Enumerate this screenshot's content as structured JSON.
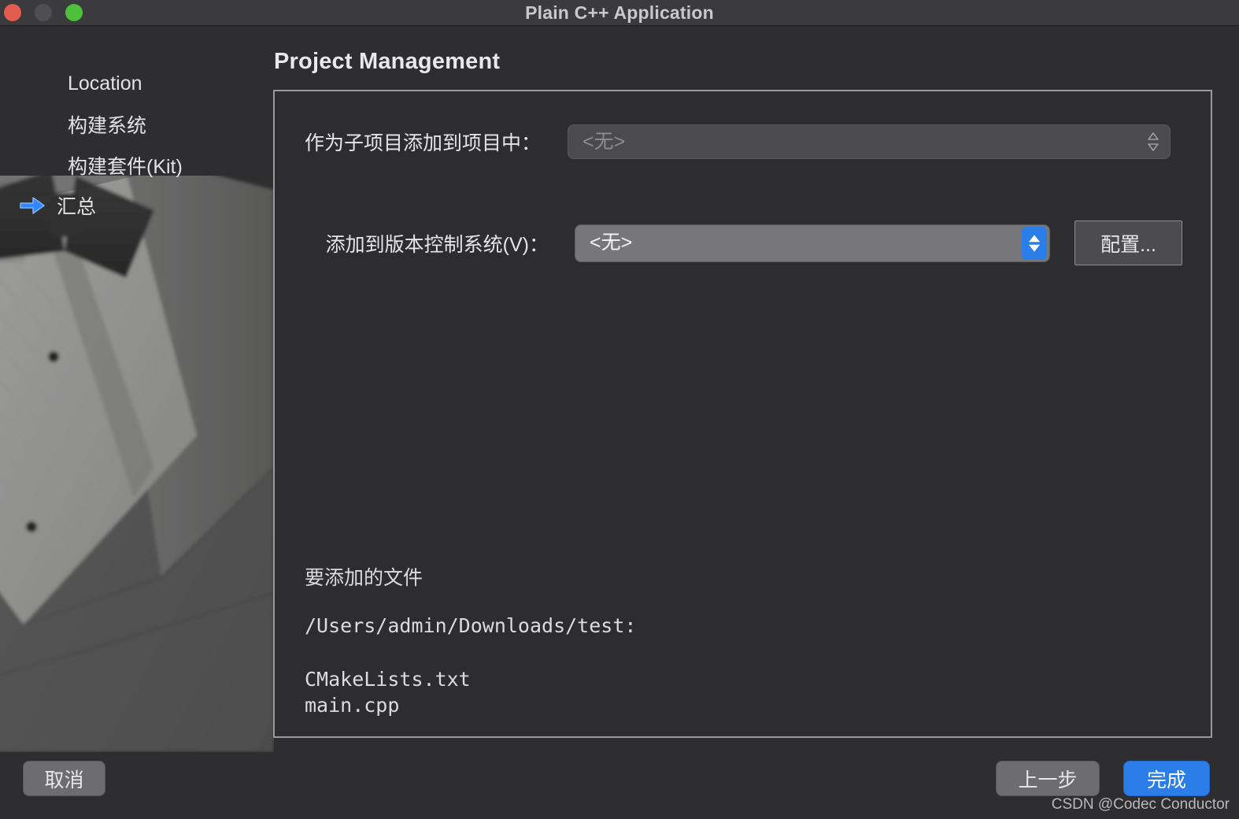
{
  "window": {
    "title": "Plain C++ Application",
    "traffic_lights": [
      {
        "name": "close-button",
        "color": "#e25c50"
      },
      {
        "name": "minimize-button",
        "color": "#4e4e53"
      },
      {
        "name": "zoom-button",
        "color": "#4ec13c"
      }
    ]
  },
  "sidebar": {
    "items": [
      {
        "label": "Location",
        "current": false
      },
      {
        "label": "构建系统",
        "current": false
      },
      {
        "label": "构建套件(Kit)",
        "current": false
      },
      {
        "label": "汇总",
        "current": true
      }
    ],
    "current_indicator_icon": "arrow-right-icon",
    "current_indicator_color": "#2f86ff"
  },
  "page": {
    "title": "Project Management"
  },
  "form": {
    "subproject": {
      "label": "作为子项目添加到项目中：",
      "value": "<无>",
      "enabled": false,
      "icon": "chevron-up-down-icon"
    },
    "version_control": {
      "label": "添加到版本控制系统(V)：",
      "value": "<无>",
      "enabled": true,
      "icon": "stepper-up-down-icon",
      "accent": "#2b7de8",
      "configure_button": "配置..."
    }
  },
  "summary": {
    "heading": "要添加的文件",
    "path": "/Users/admin/Downloads/test:",
    "files": "CMakeLists.txt\nmain.cpp"
  },
  "footer": {
    "cancel": "取消",
    "back": "上一步",
    "finish": "完成",
    "watermark": "CSDN @Codec Conductor"
  }
}
